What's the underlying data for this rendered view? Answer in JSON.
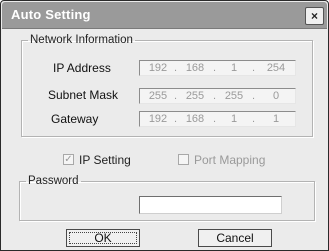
{
  "window": {
    "title": "Auto Setting",
    "close_glyph": "×"
  },
  "network_info": {
    "legend": "Network Information",
    "ip_address": {
      "label": "IP Address",
      "octets": [
        "192",
        "168",
        "1",
        "254"
      ]
    },
    "subnet_mask": {
      "label": "Subnet Mask",
      "octets": [
        "255",
        "255",
        "255",
        "0"
      ]
    },
    "gateway": {
      "label": "Gateway",
      "octets": [
        "192",
        "168",
        "1",
        "1"
      ]
    }
  },
  "options": {
    "ip_setting": {
      "label": "IP Setting",
      "checked": true,
      "mark": "✓"
    },
    "port_mapping": {
      "label": "Port Mapping",
      "checked": false,
      "mark": ""
    }
  },
  "password": {
    "legend": "Password",
    "value": ""
  },
  "buttons": {
    "ok": "OK",
    "cancel": "Cancel"
  },
  "icons": {
    "close": "close-icon",
    "check": "checkmark-icon"
  },
  "colors": {
    "titlebar": "#9a9a9a",
    "dialog_bg": "#ebebeb",
    "disabled_text": "#9a9a9a"
  }
}
